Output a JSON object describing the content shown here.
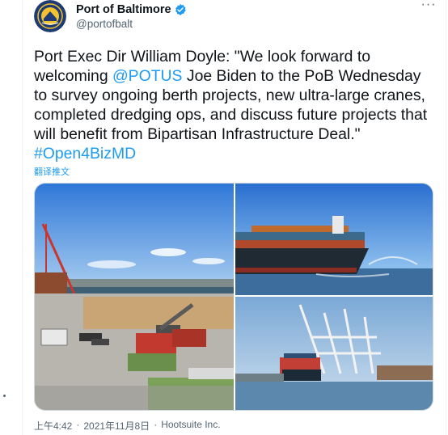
{
  "author": {
    "display_name": "Port of Baltimore",
    "handle": "@portofbalt",
    "verified": true,
    "avatar_icon": "port-of-baltimore-seal"
  },
  "menu": {
    "more_label": "···"
  },
  "tweet": {
    "segments": [
      {
        "type": "text",
        "value": "Port Exec Dir William Doyle: \"We look forward to welcoming "
      },
      {
        "type": "mention",
        "value": "@POTUS"
      },
      {
        "type": "text",
        "value": " Joe Biden to the PoB Wednesday to survey ongoing berth projects, new ultra-large cranes, completed dredging ops, and discuss future projects that will benefit from Bipartisan Infrastructure Deal.\" "
      },
      {
        "type": "hashtag",
        "value": "#Open4BizMD"
      }
    ],
    "translate_label": "翻译推文"
  },
  "media": [
    {
      "name": "port-terminal-photo"
    },
    {
      "name": "container-ship-photo"
    },
    {
      "name": "cranes-photo"
    }
  ],
  "meta": {
    "time": "上午4:42",
    "separator": "·",
    "date": "2021年11月8日",
    "source": "Hootsuite Inc."
  },
  "colors": {
    "link": "#1d9bf0",
    "text": "#0f1419",
    "secondary": "#536471",
    "border": "#cfd9de"
  }
}
